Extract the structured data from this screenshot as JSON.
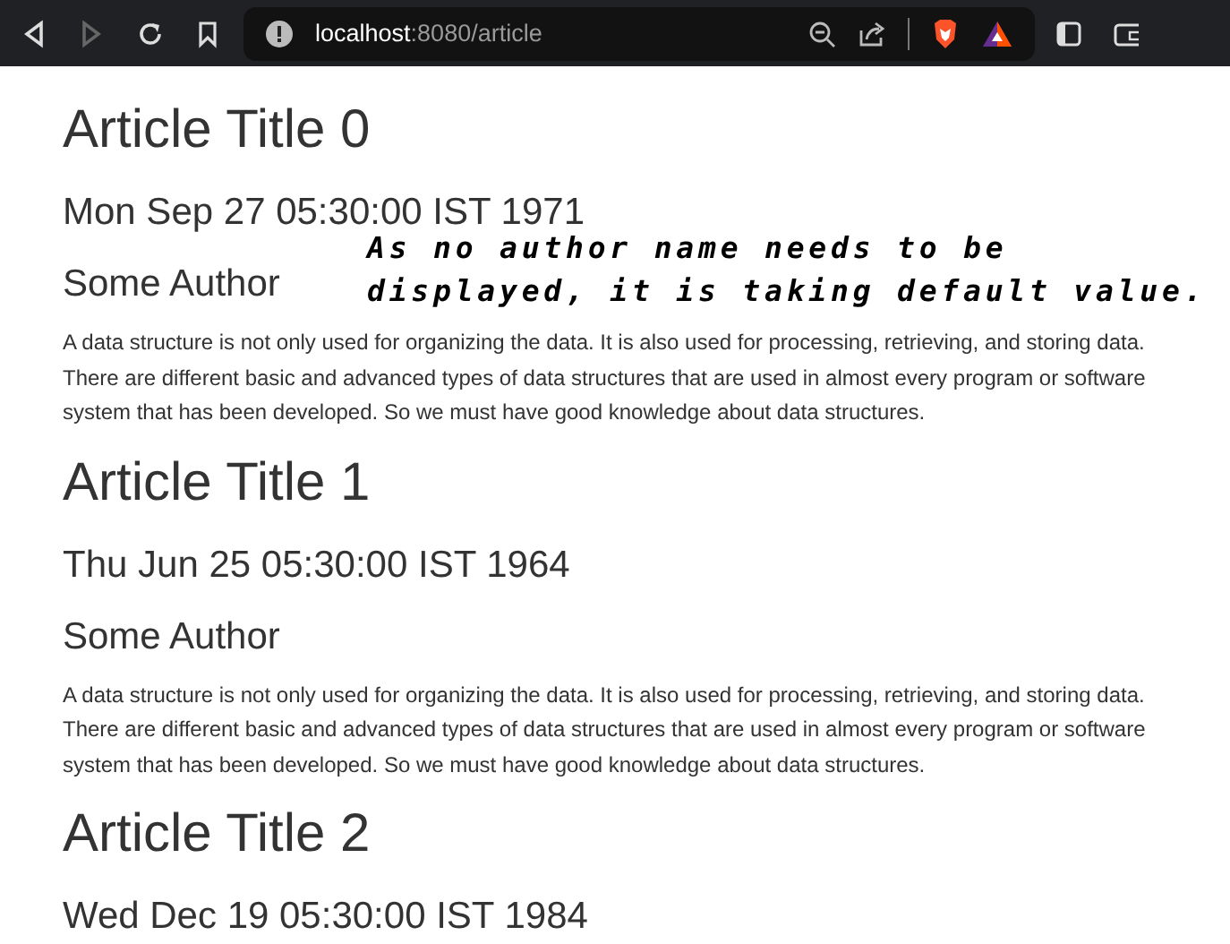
{
  "browser": {
    "url_host": "localhost",
    "url_rest": ":8080/article",
    "forward_disabled": true
  },
  "articles": [
    {
      "title": "Article Title 0",
      "date": "Mon Sep 27 05:30:00 IST 1971",
      "author": "Some Author",
      "body": "A data structure is not only used for organizing the data. It is also used for processing, retrieving, and storing data. There are different basic and advanced types of data structures that are used in almost every program or software system that has been developed. So we must have good knowledge about data structures."
    },
    {
      "title": "Article Title 1",
      "date": "Thu Jun 25 05:30:00 IST 1964",
      "author": "Some Author",
      "body": "A data structure is not only used for organizing the data. It is also used for processing, retrieving, and storing data. There are different basic and advanced types of data structures that are used in almost every program or software system that has been developed. So we must have good knowledge about data structures."
    },
    {
      "title": "Article Title 2",
      "date": "Wed Dec 19 05:30:00 IST 1984"
    }
  ],
  "annotation": "As no author name needs to be displayed, it is taking default value."
}
